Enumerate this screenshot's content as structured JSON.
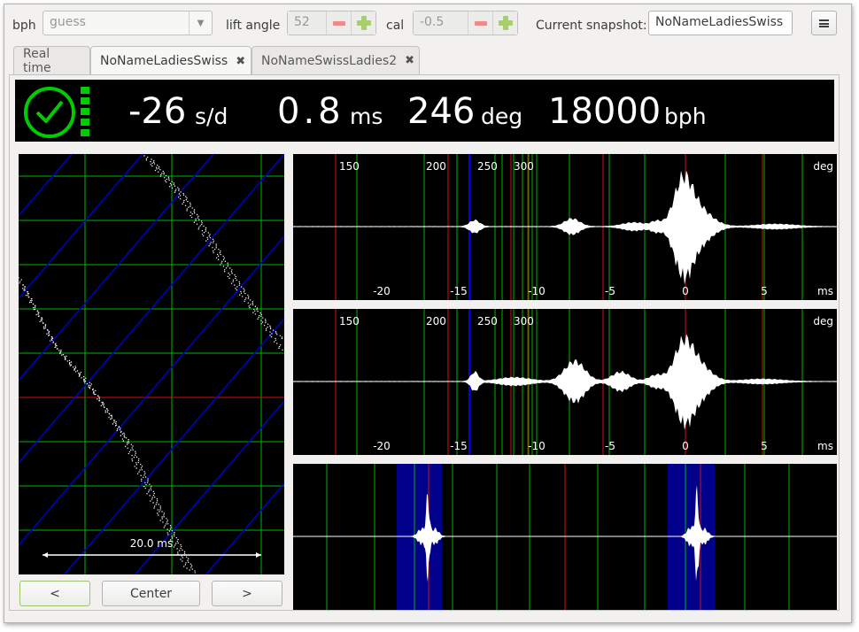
{
  "toolbar": {
    "bph_label": "bph",
    "bph_value": "guess",
    "lift_angle_label": "lift angle",
    "lift_angle_value": "52",
    "cal_label": "cal",
    "cal_value": "-0.5",
    "snapshot_label": "Current snapshot:",
    "snapshot_name": "NoNameLadiesSwiss",
    "icons": [
      "chevron-down-icon",
      "minus-icon",
      "plus-icon",
      "hamburger-menu-icon"
    ]
  },
  "tabs": [
    {
      "label": "Real time",
      "closable": false
    },
    {
      "label": "NoNameLadiesSwiss",
      "closable": true,
      "active": true
    },
    {
      "label": "NoNameSwissLadies2",
      "closable": true
    }
  ],
  "readout": {
    "rate": "-26",
    "rate_unit": "s/d",
    "beat_error": "0.8",
    "beat_error_unit": "ms",
    "amplitude": "246",
    "amplitude_unit": "deg",
    "bph": "18000",
    "bph_unit": "bph",
    "status_color": "#00cc00",
    "signal_level_bars": 5
  },
  "paperstrip": {
    "scale_label": "20.0 ms"
  },
  "scope_tic": {
    "deg_ticks": [
      "150",
      "200",
      "250",
      "300"
    ],
    "deg_unit": "deg",
    "ms_ticks": [
      "-20",
      "-15",
      "-10",
      "-5",
      "0",
      "5"
    ],
    "ms_unit": "ms"
  },
  "scope_toc": {
    "deg_ticks": [
      "150",
      "200",
      "250",
      "300"
    ],
    "deg_unit": "deg",
    "ms_ticks": [
      "-20",
      "-15",
      "-10",
      "-5",
      "0",
      "5"
    ],
    "ms_unit": "ms"
  },
  "period_view": {},
  "nav": {
    "prev_label": "<",
    "center_label": "Center",
    "next_label": ">"
  },
  "colors": {
    "grid_green": "#00b400",
    "marker_red": "#d01010",
    "marker_blue": "#0000ff",
    "highlight_blue": "#00008b"
  }
}
